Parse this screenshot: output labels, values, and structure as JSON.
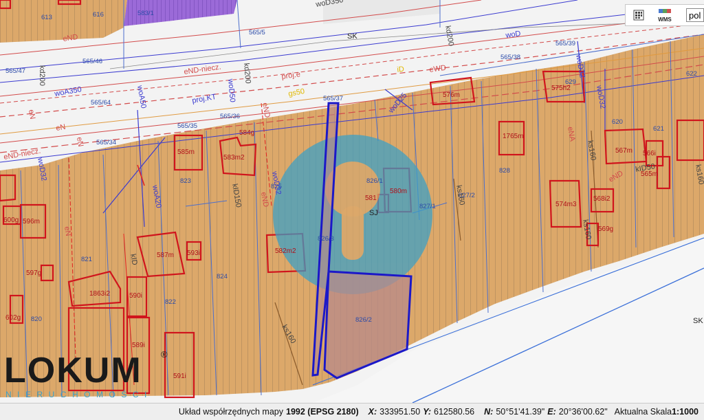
{
  "toolbar": {
    "legend_icon": "legend-grid-icon",
    "legend_label": "",
    "wms_icon": "wms-layers-icon",
    "wms_label": "WMS",
    "language": "pol"
  },
  "logo": {
    "brand": "LOKUM",
    "registered": "®",
    "tagline": "NIERUCHOMOŚCI"
  },
  "status_bar": {
    "system_label": "Układ współrzędnych mapy",
    "system_value": "1992 (EPSG 2180)",
    "x_label": "X:",
    "x_value": "333951.50",
    "y_label": "Y:",
    "y_value": "612580.56",
    "n_label": "N:",
    "n_value": "50°51'41.39\"",
    "e_label": "E:",
    "e_value": "20°36'00.62\"",
    "scale_label": "Aktualna Skala",
    "scale_value": "1:1000"
  },
  "map": {
    "colors": {
      "parcel_fill": "#dca86a",
      "street_fill": "#f4f4f4",
      "building_stroke": "#d0141c",
      "selected_parcel": "#1b18c8",
      "selected_fill": "#b88a8a",
      "watermark": "#3aa0c8",
      "utility_blue": "#3a3ad0",
      "utility_red": "#e02020"
    },
    "parcel_labels": [
      "613",
      "616",
      "583/1",
      "565/5",
      "565/46",
      "565/47",
      "565/64",
      "565/35",
      "565/34",
      "565/36",
      "565/37",
      "565/38",
      "565/39",
      "823",
      "821",
      "822",
      "824",
      "820",
      "825",
      "826/1",
      "827/1",
      "827/2",
      "828",
      "826/3",
      "826/2",
      "620",
      "621",
      "622",
      "629"
    ],
    "building_labels": [
      "585m",
      "583m2",
      "584g",
      "596m",
      "600g",
      "597g",
      "587m",
      "593i",
      "582m2",
      "1863i2",
      "590i",
      "602g",
      "589i",
      "591i",
      "576m",
      "575h2",
      "1765m",
      "580m",
      "581",
      "567m",
      "566i",
      "565m",
      "574m3",
      "568i2",
      "569g"
    ],
    "utility_labels": [
      "eND",
      "eND-niecz.",
      "kd200",
      "woA350",
      "woA50",
      "woD50",
      "kd200",
      "woD350",
      "woD",
      "kd200",
      "proj.e",
      "iD",
      "eWD",
      "woD25",
      "woD32",
      "woD32",
      "proj.KT",
      "eND",
      "eN",
      "woD32",
      "eN",
      "woA20",
      "kID150",
      "eND",
      "woD32",
      "eN",
      "eN",
      "kID",
      "ks160",
      "ks160",
      "ks160",
      "eNA",
      "ks160",
      "eND",
      "kID50",
      "ks160",
      "gs50",
      "SK",
      "SK",
      "SJ",
      "eND-niecz."
    ]
  }
}
